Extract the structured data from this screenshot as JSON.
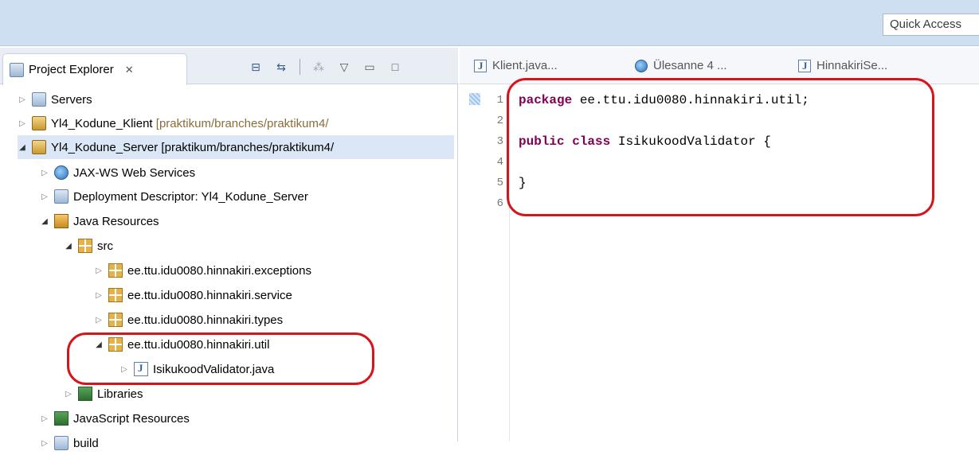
{
  "toolbar": {
    "quick_access_placeholder": "Quick Access"
  },
  "project_explorer": {
    "title": "Project Explorer",
    "close_symbol": "✕",
    "tree": [
      {
        "label": "Servers",
        "icon": "folder-icon",
        "arrow": "▷",
        "level": 0
      },
      {
        "label": "Yl4_Kodune_Klient",
        "suffix": " [praktikum/branches/praktikum4/",
        "icon": "project-icon",
        "arrow": "▷",
        "level": 0
      },
      {
        "label": "Yl4_Kodune_Server",
        "suffix": " [praktikum/branches/praktikum4/",
        "icon": "project-icon",
        "arrow": "◢",
        "level": 0
      },
      {
        "label": "JAX-WS Web Services",
        "icon": "webservice-icon",
        "arrow": "▷",
        "level": 1
      },
      {
        "label": "Deployment Descriptor: Yl4_Kodune_Server",
        "icon": "descriptor-icon",
        "arrow": "▷",
        "level": 1
      },
      {
        "label": "Java Resources",
        "icon": "java-resources-icon",
        "arrow": "◢",
        "level": 1
      },
      {
        "label": "src",
        "icon": "source-folder-icon",
        "arrow": "◢",
        "level": 2
      },
      {
        "label": "ee.ttu.idu0080.hinnakiri.exceptions",
        "icon": "package-icon",
        "arrow": "▷",
        "level": 3
      },
      {
        "label": "ee.ttu.idu0080.hinnakiri.service",
        "icon": "package-icon",
        "arrow": "▷",
        "level": 3
      },
      {
        "label": "ee.ttu.idu0080.hinnakiri.types",
        "icon": "package-icon",
        "arrow": "▷",
        "level": 3
      },
      {
        "label": "ee.ttu.idu0080.hinnakiri.util",
        "icon": "package-icon",
        "arrow": "◢",
        "level": 3
      },
      {
        "label": "IsikukoodValidator.java",
        "icon": "java-file-icon",
        "arrow": "▷",
        "level": 4
      },
      {
        "label": "Libraries",
        "icon": "library-icon",
        "arrow": "▷",
        "level": 2
      },
      {
        "label": "JavaScript Resources",
        "icon": "library-icon",
        "arrow": "▷",
        "level": 1
      },
      {
        "label": "build",
        "icon": "folder-icon",
        "arrow": "▷",
        "level": 1
      }
    ]
  },
  "editor": {
    "tabs": [
      {
        "label": "Klient.java...",
        "icon": "java-file-icon"
      },
      {
        "label": "Ülesanne 4 ...",
        "icon": "web-browser-icon"
      },
      {
        "label": "HinnakiriSe...",
        "icon": "java-file-icon"
      }
    ],
    "line_numbers": [
      "1",
      "2",
      "3",
      "4",
      "5",
      "6"
    ],
    "code": {
      "line1_kw": "package",
      "line1_rest": " ee.ttu.idu0080.hinnakiri.util;",
      "line3_kw1": "public",
      "line3_kw2": "class",
      "line3_rest": " IsikukoodValidator {",
      "line5": "}"
    }
  },
  "colors": {
    "toolbar_bg": "#cddff0",
    "annotation_red": "#d8141b",
    "keyword": "#7f0055"
  }
}
